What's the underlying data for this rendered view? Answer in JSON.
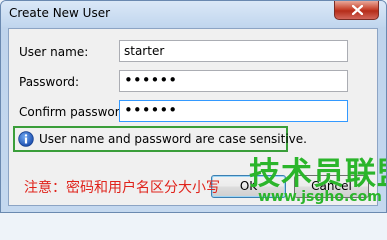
{
  "window": {
    "title": "Create New User",
    "close_icon": "close-icon"
  },
  "form": {
    "username_label": "User name:",
    "username_value": "starter",
    "password_label": "Password:",
    "password_value": "••••••",
    "confirm_label": "Confirm password:",
    "confirm_value": "••••••"
  },
  "info": {
    "icon": "info-icon",
    "text": "User name and password are case sensitive."
  },
  "buttons": {
    "ok_label": "OK",
    "cancel_label": "Cancel"
  },
  "annotation": {
    "note_text": "注意：密码和用户名区分大小写",
    "note_color": "#e0231b",
    "highlight_color": "#3a9e3a"
  },
  "watermark": {
    "name": "技术员联盟",
    "url": "www.jsgho.com"
  }
}
